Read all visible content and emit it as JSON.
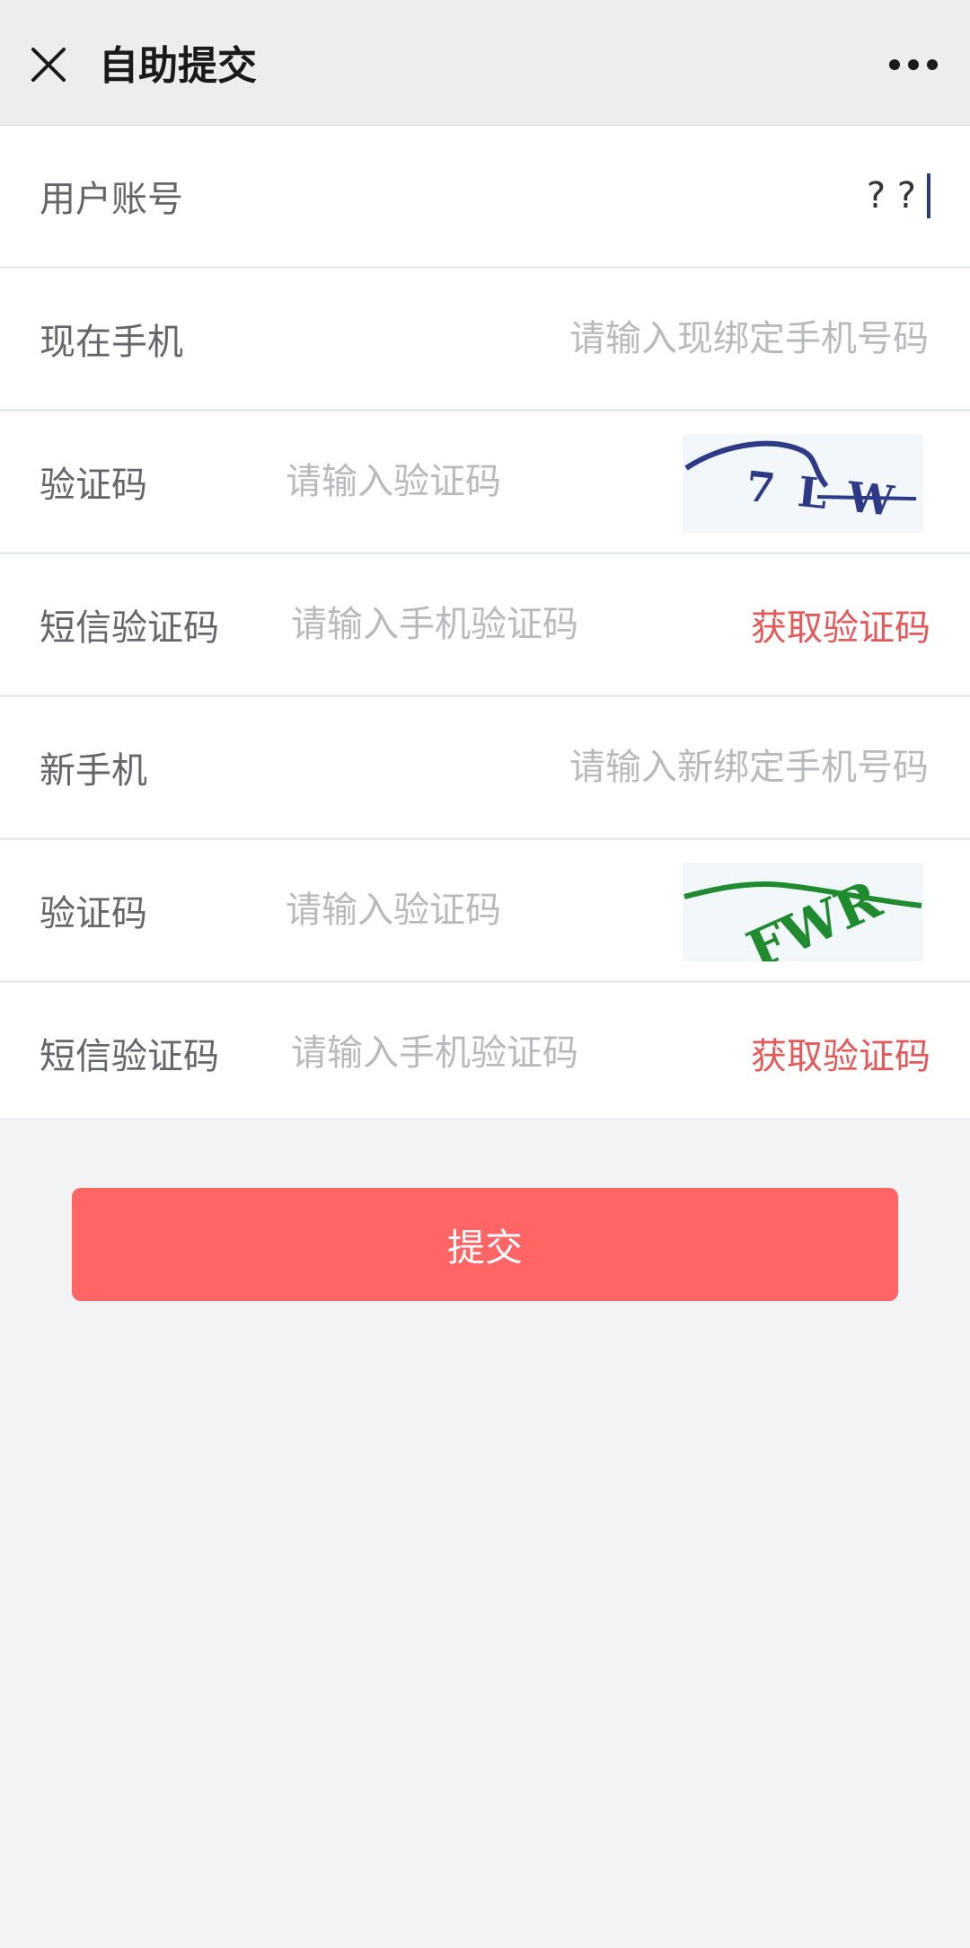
{
  "header": {
    "title": "自助提交",
    "close_icon": "close-icon",
    "more_icon": "more-horizontal-icon"
  },
  "form": {
    "account": {
      "label": "用户账号",
      "value": "? ?"
    },
    "current_phone": {
      "label": "现在手机",
      "placeholder": "请输入现绑定手机号码"
    },
    "captcha1": {
      "label": "验证码",
      "placeholder": "请输入验证码",
      "image_text": "7LW"
    },
    "sms1": {
      "label": "短信验证码",
      "placeholder": "请输入手机验证码",
      "button": "获取验证码"
    },
    "new_phone": {
      "label": "新手机",
      "placeholder": "请输入新绑定手机号码"
    },
    "captcha2": {
      "label": "验证码",
      "placeholder": "请输入验证码",
      "image_text": "FWR"
    },
    "sms2": {
      "label": "短信验证码",
      "placeholder": "请输入手机验证码",
      "button": "获取验证码"
    }
  },
  "submit_label": "提交",
  "colors": {
    "accent": "#ff6565",
    "sms_text": "#e5595a",
    "captcha1_ink": "#2f3a86",
    "captcha2_ink": "#1f8a2e"
  }
}
